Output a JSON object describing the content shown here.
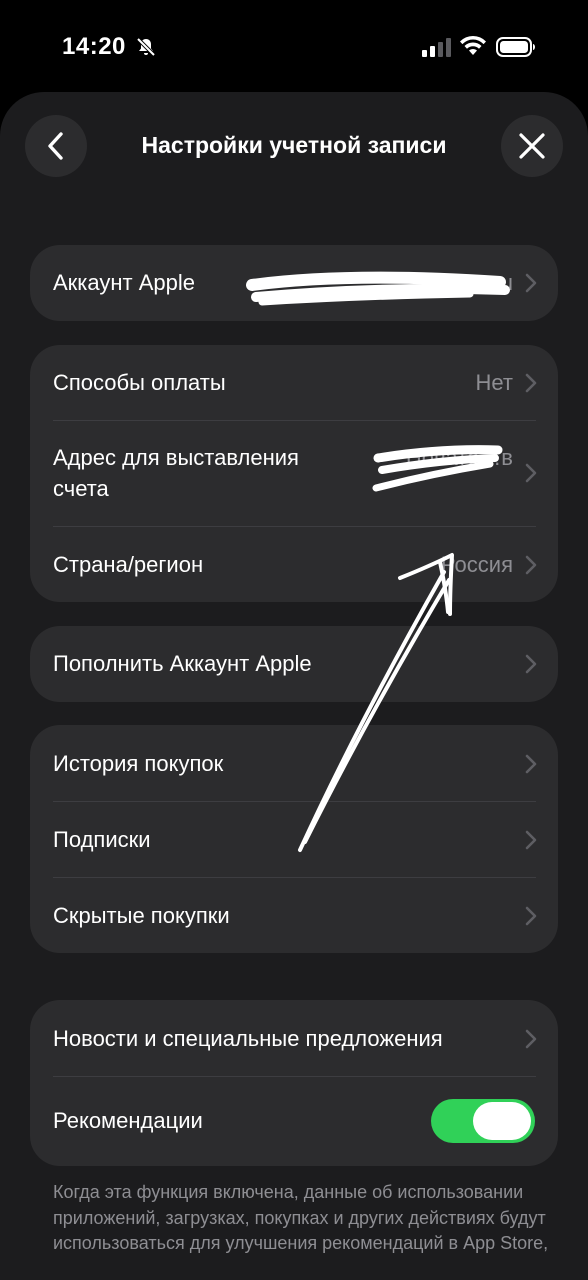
{
  "status_bar": {
    "time": "14:20"
  },
  "nav": {
    "title": "Настройки учетной записи"
  },
  "groups": {
    "account": {
      "label": "Аккаунт Apple",
      "value": "gr…u"
    },
    "billing": {
      "payment": {
        "label": "Способы оплаты",
        "value": "Нет"
      },
      "address": {
        "label": "Адрес для выставления счета",
        "value": "Новато…в"
      },
      "country": {
        "label": "Страна/регион",
        "value": "Россия"
      }
    },
    "topup": {
      "label": "Пополнить Аккаунт Apple"
    },
    "purchases": {
      "history": {
        "label": "История покупок"
      },
      "subscriptions": {
        "label": "Подписки"
      },
      "hidden": {
        "label": "Скрытые покупки"
      }
    },
    "prefs": {
      "news": {
        "label": "Новости и специальные предложения"
      },
      "recommendations": {
        "label": "Рекомендации",
        "enabled": true
      }
    }
  },
  "footer_text": "Когда эта функция включена, данные об использовании приложений, загрузках, покупках и других действиях будут использоваться для улучшения рекомендаций в App Store,",
  "colors": {
    "toggle_on": "#30d158",
    "sheet_bg": "#1c1c1e",
    "group_bg": "#2c2c2e",
    "secondary_text": "#8e8e93"
  }
}
